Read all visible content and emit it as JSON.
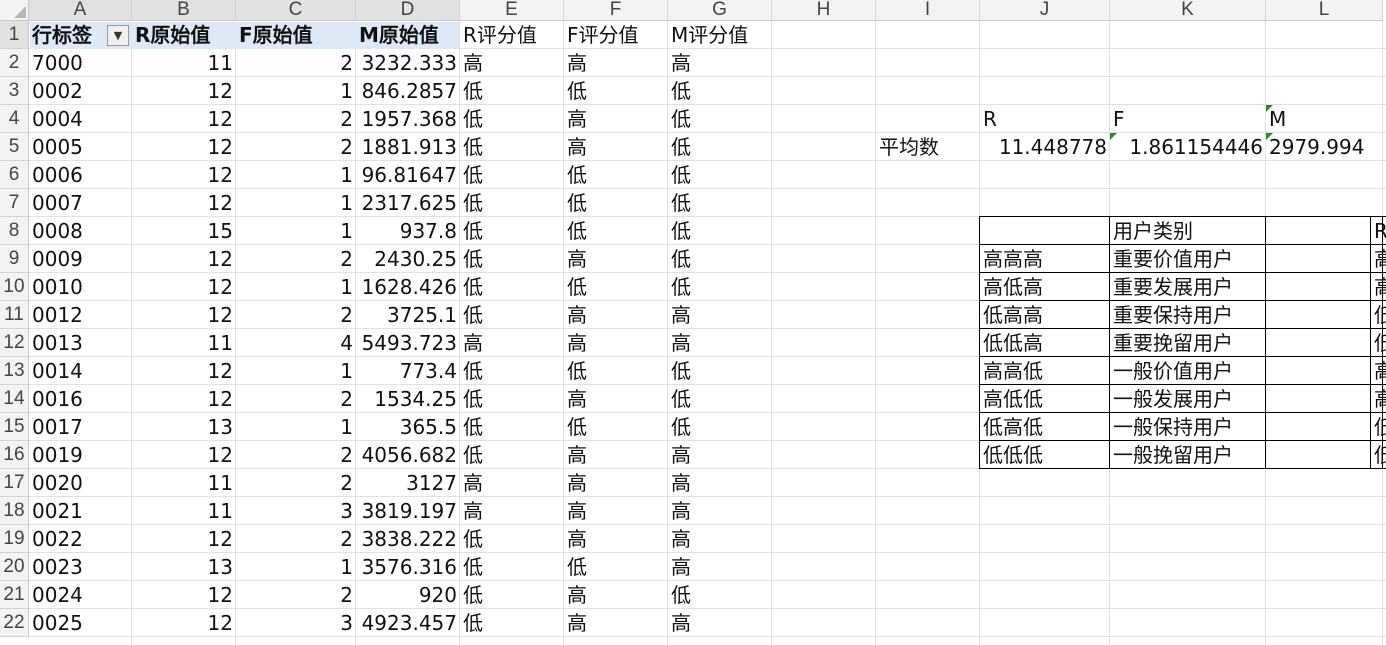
{
  "columns": [
    "A",
    "B",
    "C",
    "D",
    "E",
    "F",
    "G",
    "H",
    "I",
    "J",
    "K",
    "L"
  ],
  "rows": [
    "1",
    "2",
    "3",
    "4",
    "5",
    "6",
    "7",
    "8",
    "9",
    "10",
    "11",
    "12",
    "13",
    "14",
    "15",
    "16",
    "17",
    "18",
    "19",
    "20",
    "21",
    "22"
  ],
  "pivot": {
    "headers": [
      "行标签",
      "R原始值",
      "F原始值",
      "M原始值"
    ],
    "score_headers": [
      "R评分值",
      "F评分值",
      "M评分值"
    ],
    "filter_icon": "filter-dropdown-icon",
    "data": [
      [
        "7000",
        "11",
        "2",
        "3232.333",
        "高",
        "高",
        "高"
      ],
      [
        "0002",
        "12",
        "1",
        "846.2857",
        "低",
        "低",
        "低"
      ],
      [
        "0004",
        "12",
        "2",
        "1957.368",
        "低",
        "高",
        "低"
      ],
      [
        "0005",
        "12",
        "2",
        "1881.913",
        "低",
        "高",
        "低"
      ],
      [
        "0006",
        "12",
        "1",
        "96.81647",
        "低",
        "低",
        "低"
      ],
      [
        "0007",
        "12",
        "1",
        "2317.625",
        "低",
        "低",
        "低"
      ],
      [
        "0008",
        "15",
        "1",
        "937.8",
        "低",
        "低",
        "低"
      ],
      [
        "0009",
        "12",
        "2",
        "2430.25",
        "低",
        "高",
        "低"
      ],
      [
        "0010",
        "12",
        "1",
        "1628.426",
        "低",
        "低",
        "低"
      ],
      [
        "0012",
        "12",
        "2",
        "3725.1",
        "低",
        "高",
        "高"
      ],
      [
        "0013",
        "11",
        "4",
        "5493.723",
        "高",
        "高",
        "高"
      ],
      [
        "0014",
        "12",
        "1",
        "773.4",
        "低",
        "低",
        "低"
      ],
      [
        "0016",
        "12",
        "2",
        "1534.25",
        "低",
        "高",
        "低"
      ],
      [
        "0017",
        "13",
        "1",
        "365.5",
        "低",
        "低",
        "低"
      ],
      [
        "0019",
        "12",
        "2",
        "4056.682",
        "低",
        "高",
        "高"
      ],
      [
        "0020",
        "11",
        "2",
        "3127",
        "高",
        "高",
        "高"
      ],
      [
        "0021",
        "11",
        "3",
        "3819.197",
        "高",
        "高",
        "高"
      ],
      [
        "0022",
        "12",
        "2",
        "3838.222",
        "低",
        "高",
        "高"
      ],
      [
        "0023",
        "13",
        "1",
        "3576.316",
        "低",
        "低",
        "高"
      ],
      [
        "0024",
        "12",
        "2",
        "920",
        "低",
        "高",
        "低"
      ],
      [
        "0025",
        "12",
        "3",
        "4923.457",
        "低",
        "高",
        "高"
      ]
    ]
  },
  "averages": {
    "r_label": "R",
    "f_label": "F",
    "m_label": "M",
    "row_label": "平均数",
    "r_value": "11.448778",
    "f_value": "1.861154446",
    "m_value": "2979.994"
  },
  "category_table": {
    "header": "用户类别",
    "extra_header_partial": "R",
    "rows": [
      [
        "高高高",
        "重要价值用户",
        "高"
      ],
      [
        "高低高",
        "重要发展用户",
        "高"
      ],
      [
        "低高高",
        "重要保持用户",
        "低"
      ],
      [
        "低低高",
        "重要挽留用户",
        "低"
      ],
      [
        "高高低",
        "一般价值用户",
        "高"
      ],
      [
        "高低低",
        "一般发展用户",
        "高"
      ],
      [
        "低高低",
        "一般保持用户",
        "低"
      ],
      [
        "低低低",
        "一般挽留用户",
        "低"
      ]
    ]
  }
}
